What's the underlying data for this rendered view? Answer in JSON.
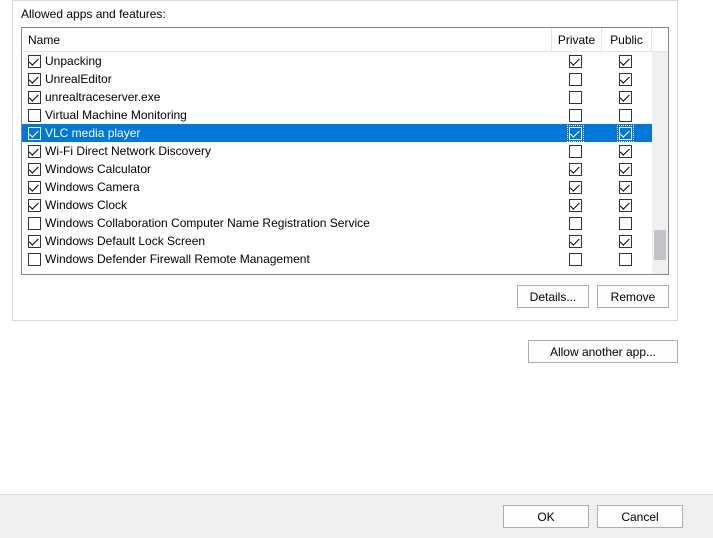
{
  "panel": {
    "label": "Allowed apps and features:"
  },
  "columns": {
    "name": "Name",
    "private": "Private",
    "public": "Public"
  },
  "rows": [
    {
      "name": "Unpacking",
      "enabled": true,
      "private": true,
      "public": true,
      "selected": false
    },
    {
      "name": "UnrealEditor",
      "enabled": true,
      "private": false,
      "public": true,
      "selected": false
    },
    {
      "name": "unrealtraceserver.exe",
      "enabled": true,
      "private": false,
      "public": true,
      "selected": false
    },
    {
      "name": "Virtual Machine Monitoring",
      "enabled": false,
      "private": false,
      "public": false,
      "selected": false
    },
    {
      "name": "VLC media player",
      "enabled": true,
      "private": true,
      "public": true,
      "selected": true
    },
    {
      "name": "Wi-Fi Direct Network Discovery",
      "enabled": true,
      "private": false,
      "public": true,
      "selected": false
    },
    {
      "name": "Windows Calculator",
      "enabled": true,
      "private": true,
      "public": true,
      "selected": false
    },
    {
      "name": "Windows Camera",
      "enabled": true,
      "private": true,
      "public": true,
      "selected": false
    },
    {
      "name": "Windows Clock",
      "enabled": true,
      "private": true,
      "public": true,
      "selected": false
    },
    {
      "name": "Windows Collaboration Computer Name Registration Service",
      "enabled": false,
      "private": false,
      "public": false,
      "selected": false
    },
    {
      "name": "Windows Default Lock Screen",
      "enabled": true,
      "private": true,
      "public": true,
      "selected": false
    },
    {
      "name": "Windows Defender Firewall Remote Management",
      "enabled": false,
      "private": false,
      "public": false,
      "selected": false
    }
  ],
  "buttons": {
    "details": "Details...",
    "remove": "Remove",
    "allow_another": "Allow another app...",
    "ok": "OK",
    "cancel": "Cancel"
  }
}
